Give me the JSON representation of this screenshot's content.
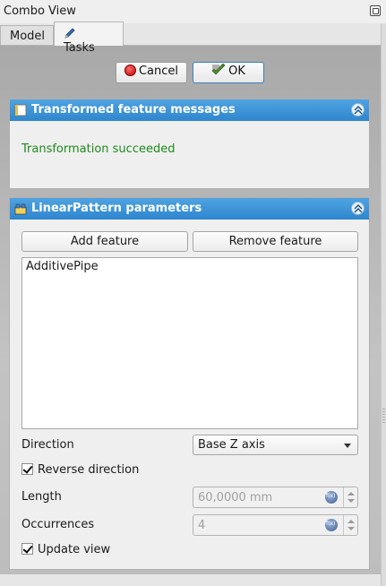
{
  "window": {
    "title": "Combo View"
  },
  "tabs": [
    {
      "label": "Model",
      "active": false
    },
    {
      "label": "Tasks",
      "active": true
    }
  ],
  "dialog_buttons": {
    "cancel_label": "Cancel",
    "ok_label": "OK"
  },
  "messages_section": {
    "title": "Transformed feature messages",
    "message": "Transformation succeeded",
    "message_color": "#1e8a1e"
  },
  "params_section": {
    "title": "LinearPattern parameters",
    "add_feature_label": "Add feature",
    "remove_feature_label": "Remove feature",
    "features": [
      "AdditivePipe"
    ],
    "direction_label": "Direction",
    "direction_value": "Base Z axis",
    "reverse_label": "Reverse direction",
    "reverse_checked": true,
    "length_label": "Length",
    "length_value": "60,0000 mm",
    "occurrences_label": "Occurrences",
    "occurrences_value": "4",
    "update_view_label": "Update view",
    "update_view_checked": true
  },
  "colors": {
    "header_blue": "#2f86cf",
    "success_green": "#1e8a1e"
  },
  "icons": [
    "float-icon",
    "pencil-icon",
    "cancel-icon",
    "ok-icon",
    "document-icon",
    "linear-pattern-icon",
    "collapse-icon",
    "expression-icon"
  ]
}
